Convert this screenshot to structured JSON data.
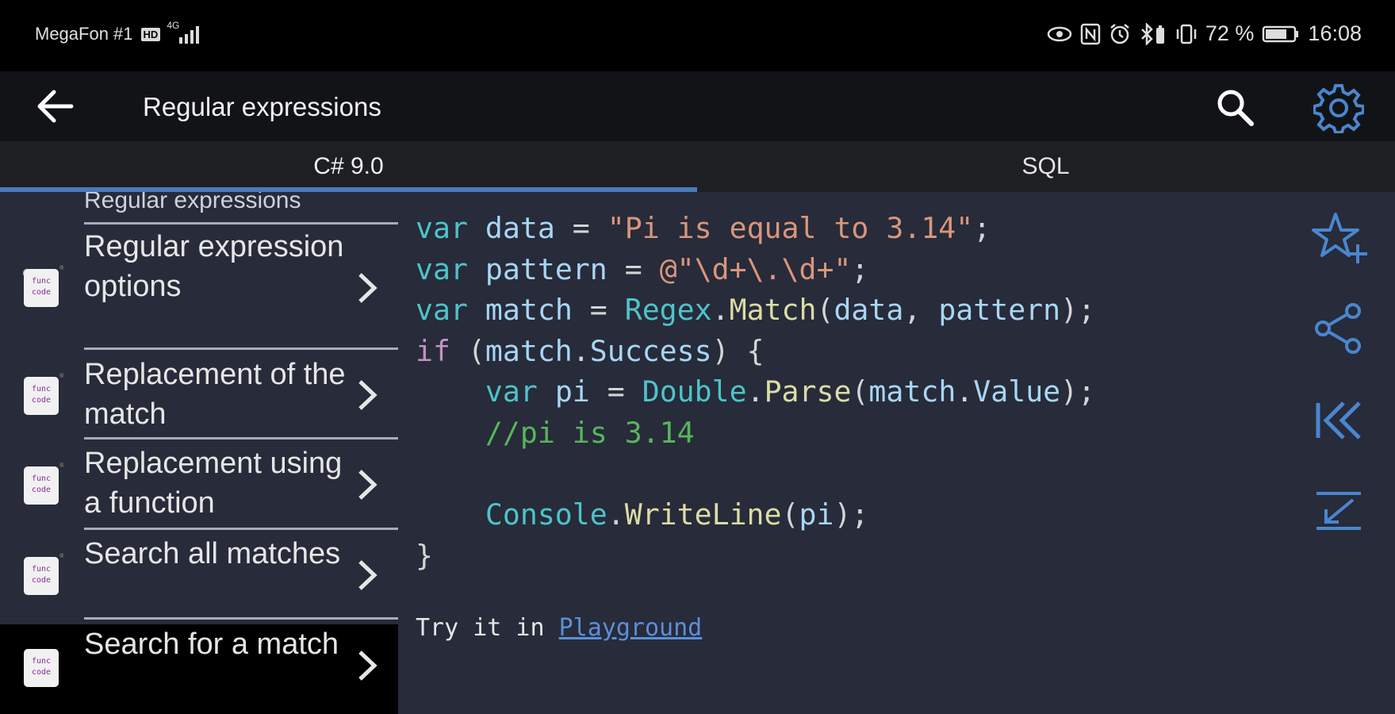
{
  "status_bar": {
    "carrier": "MegaFon #1",
    "hd_badge": "HD",
    "network": "4G",
    "battery": "72 %",
    "time": "16:08"
  },
  "app_bar": {
    "title": "Regular expressions",
    "icons": [
      "back-arrow-icon",
      "search-icon",
      "gear-icon"
    ]
  },
  "tabs": [
    {
      "label": "C# 9.0",
      "selected": true
    },
    {
      "label": "SQL",
      "selected": false
    }
  ],
  "sidebar": {
    "header": "Regular expressions",
    "items": [
      {
        "label": "Regular expression options",
        "icon": "func-code-icon"
      },
      {
        "label": "Replacement of the match",
        "icon": "func-code-icon"
      },
      {
        "label": "Replacement using a function",
        "icon": "func-code-icon"
      },
      {
        "label": "Search all matches",
        "icon": "func-code-icon"
      },
      {
        "label": "Search for a match",
        "icon": "func-code-icon",
        "selected": true
      }
    ]
  },
  "code": {
    "lines": [
      "var data = \"Pi is equal to 3.14\";",
      "var pattern = @\"\\d+\\.\\d+\";",
      "var match = Regex.Match(data, pattern);",
      "if (match.Success) {",
      "    var pi = Double.Parse(match.Value);",
      "    //pi is 3.14",
      "",
      "    Console.WriteLine(pi);",
      "}"
    ],
    "try_prefix": "Try it in",
    "playground_link": "Playground"
  },
  "right_rail": [
    "star-plus-icon",
    "share-icon",
    "first-page-icon",
    "collapse-icon"
  ],
  "colors": {
    "accent": "#4a7ab8",
    "background": "#272b3a",
    "keyword": "#4ec3c9",
    "identifier": "#a8d6f3",
    "string": "#d9967b",
    "control": "#c590c2",
    "function": "#dcdca5",
    "comment": "#58b55c",
    "link": "#5b8fd6"
  }
}
